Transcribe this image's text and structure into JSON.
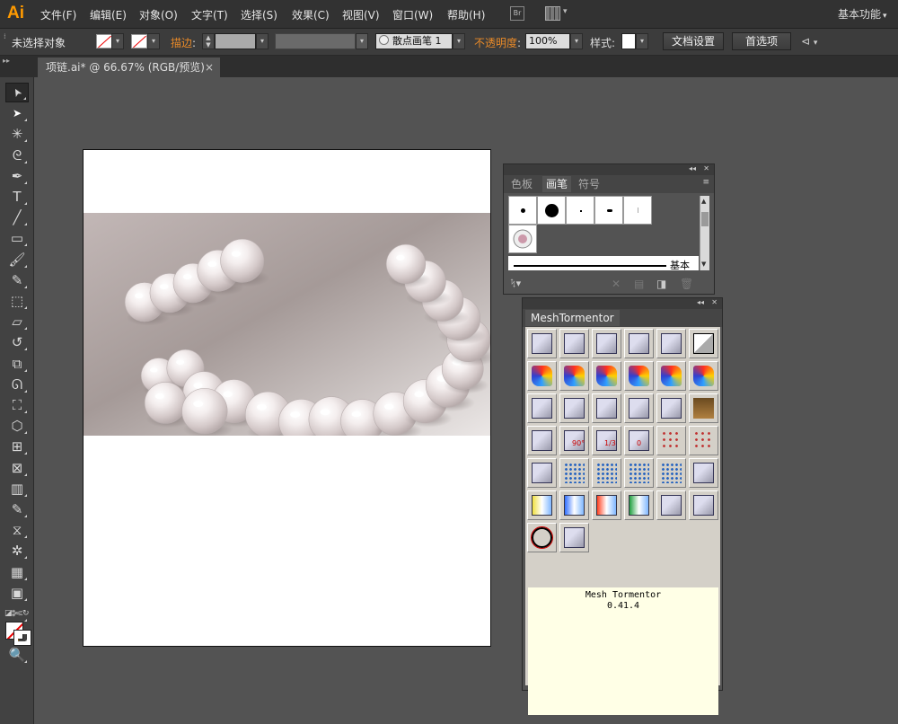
{
  "app": {
    "logo": "Ai"
  },
  "menu": [
    "文件(F)",
    "编辑(E)",
    "对象(O)",
    "文字(T)",
    "选择(S)",
    "效果(C)",
    "视图(V)",
    "窗口(W)",
    "帮助(H)"
  ],
  "bridge_label": "Br",
  "workspace": {
    "label": "基本功能",
    "caret": "▾"
  },
  "control_bar": {
    "selection_status": "未选择对象",
    "stroke_label": "描边",
    "colon": ":",
    "brush_name": "散点画笔 1",
    "opacity_label": "不透明度",
    "opacity_value": "100%",
    "style_label": "样式",
    "doc_setup": "文档设置",
    "prefs": "首选项",
    "dd": "▾"
  },
  "document": {
    "tab_title": "项链.ai* @ 66.67% (RGB/预览)",
    "close": "×"
  },
  "tools": [
    "selection-tool",
    "direct-selection-tool",
    "magic-wand-tool",
    "lasso-tool",
    "pen-tool",
    "type-tool",
    "line-tool",
    "rectangle-tool",
    "paintbrush-tool",
    "pencil-tool",
    "blob-brush-tool",
    "eraser-tool",
    "rotate-tool",
    "scale-tool",
    "warp-tool",
    "free-transform-tool",
    "shape-builder-tool",
    "perspective-grid-tool",
    "mesh-tool",
    "gradient-tool",
    "eyedropper-tool",
    "blend-tool",
    "symbol-sprayer-tool",
    "column-graph-tool",
    "artboard-tool",
    "slice-tool",
    "hand-tool",
    "zoom-tool"
  ],
  "tool_glyphs": {
    "type-tool": "T"
  },
  "brushes_panel": {
    "tabs": [
      "色板",
      "画笔",
      "符号"
    ],
    "selected_tab": 1,
    "basic_label": "基本",
    "footer_icons": [
      "brush-library-icon",
      "remove-stroke-icon",
      "options-icon",
      "new-brush-icon",
      "delete-brush-icon"
    ]
  },
  "mesh_panel": {
    "title": "MeshTormentor",
    "info_name": "Mesh Tormentor",
    "info_version": "0.41.4",
    "rows": 7,
    "label_ninety": "90°",
    "label_third": "1/3",
    "label_zero": "0"
  },
  "colors": {
    "logo": "#ff9a00",
    "stroke_label": "#e98a28",
    "panel_bg": "#535353",
    "canvas_bg": "#535353",
    "mesh_info_bg": "#ffffe6"
  }
}
